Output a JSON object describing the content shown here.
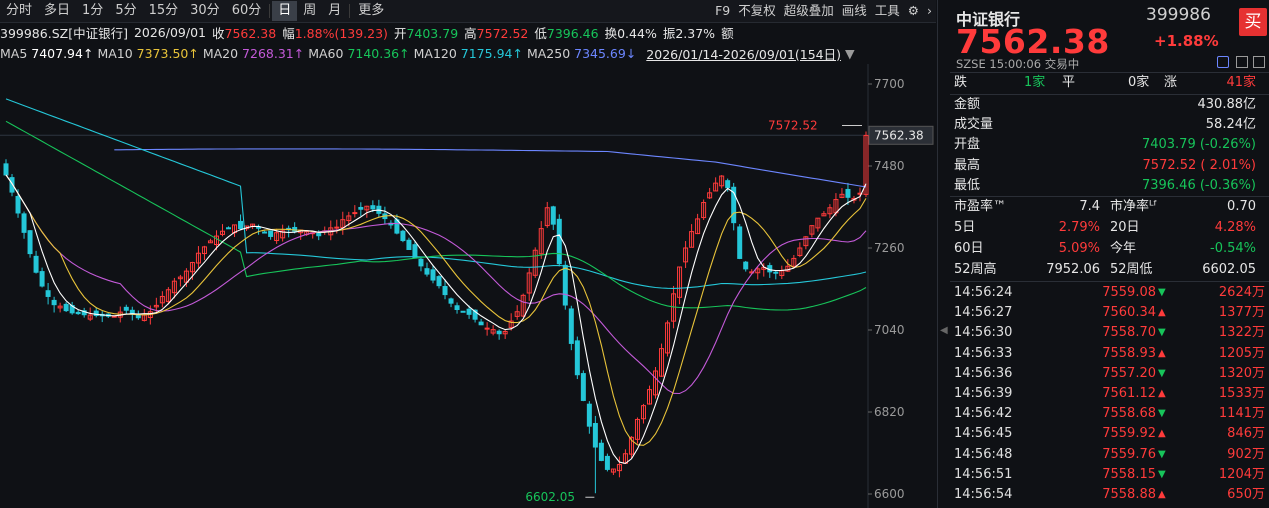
{
  "toolbar": {
    "periods": [
      "分时",
      "多日",
      "1分",
      "5分",
      "15分",
      "30分",
      "60分",
      "日",
      "周",
      "月",
      "更多"
    ],
    "active": "日",
    "right": [
      "F9",
      "不复权",
      "超级叠加",
      "画线",
      "工具"
    ],
    "gear": "gear-icon",
    "chevron": "chevron-right-icon"
  },
  "info": {
    "code": "399986.SZ[中证银行]",
    "date": "2026/09/01",
    "close_label": "收",
    "close": "7562.38",
    "change_label": "幅",
    "change": "1.88%(139.23)",
    "open_label": "开",
    "open": "7403.79",
    "high_label": "高",
    "high": "7572.52",
    "low_label": "低",
    "low": "7396.46",
    "turnover_label": "换",
    "turnover": "0.44%",
    "amplitude_label": "振",
    "amplitude": "2.37%",
    "amount_label": "额"
  },
  "ma": {
    "items": [
      {
        "label": "MA5",
        "value": "7407.94↑",
        "color": "#ffffff"
      },
      {
        "label": "MA10",
        "value": "7373.50↑",
        "color": "#e8c33a"
      },
      {
        "label": "MA20",
        "value": "7268.31↑",
        "color": "#c35ad8"
      },
      {
        "label": "MA60",
        "value": "7140.36↑",
        "color": "#17c45a"
      },
      {
        "label": "MA120",
        "value": "7175.94↑",
        "color": "#25c7d8"
      },
      {
        "label": "MA250",
        "value": "7345.69↓",
        "color": "#6c86ff"
      }
    ],
    "range": "2026/01/14-2026/09/01(154日)"
  },
  "quote": {
    "name": "中证银行",
    "code": "399986",
    "price": "7562.38",
    "pct": "+1.88%",
    "buy": "买",
    "market": "SZSE",
    "time": "15:00:06",
    "status": "交易中",
    "breadth": {
      "down_label": "跌",
      "down": "1家",
      "flat_label": "平",
      "flat": "0家",
      "up_label": "涨",
      "up": "41家"
    },
    "stats": [
      {
        "label": "金额",
        "value": "430.88亿",
        "cls": "white"
      },
      {
        "label": "成交量",
        "value": "58.24亿",
        "cls": "white"
      },
      {
        "label": "开盘",
        "value": "7403.79 (-0.26%)",
        "cls": "green"
      },
      {
        "label": "最高",
        "value": "7572.52 ( 2.01%)",
        "cls": "red"
      },
      {
        "label": "最低",
        "value": "7396.46 (-0.36%)",
        "cls": "green"
      }
    ],
    "valuation": [
      {
        "l1": "市盈率™",
        "v1": "7.4",
        "c1": "white",
        "l2": "市净率ᴸᶠ",
        "v2": "0.70",
        "c2": "white"
      },
      {
        "l1": "5日",
        "v1": "2.79%",
        "c1": "red",
        "l2": "20日",
        "v2": "4.28%",
        "c2": "red"
      },
      {
        "l1": "60日",
        "v1": "5.09%",
        "c1": "red",
        "l2": "今年",
        "v2": "-0.54%",
        "c2": "green"
      },
      {
        "l1": "52周高",
        "v1": "7952.06",
        "c1": "white",
        "l2": "52周低",
        "v2": "6602.05",
        "c2": "white"
      }
    ],
    "ticks": [
      {
        "time": "14:56:24",
        "price": "7559.08",
        "dir": "down",
        "vol": "2624万"
      },
      {
        "time": "14:56:27",
        "price": "7560.34",
        "dir": "up",
        "vol": "1377万"
      },
      {
        "time": "14:56:30",
        "price": "7558.70",
        "dir": "down",
        "vol": "1322万"
      },
      {
        "time": "14:56:33",
        "price": "7558.93",
        "dir": "up",
        "vol": "1205万"
      },
      {
        "time": "14:56:36",
        "price": "7557.20",
        "dir": "down",
        "vol": "1320万"
      },
      {
        "time": "14:56:39",
        "price": "7561.12",
        "dir": "up",
        "vol": "1533万"
      },
      {
        "time": "14:56:42",
        "price": "7558.68",
        "dir": "down",
        "vol": "1141万"
      },
      {
        "time": "14:56:45",
        "price": "7559.92",
        "dir": "up",
        "vol": "846万"
      },
      {
        "time": "14:56:48",
        "price": "7559.76",
        "dir": "down",
        "vol": "902万"
      },
      {
        "time": "14:56:51",
        "price": "7558.15",
        "dir": "down",
        "vol": "1204万"
      },
      {
        "time": "14:56:54",
        "price": "7558.88",
        "dir": "up",
        "vol": "650万"
      }
    ]
  },
  "chart_data": {
    "type": "candlestick",
    "title": "399986.SZ[中证银行]",
    "y_ticks": [
      7700,
      7480,
      7260,
      7040,
      6820,
      6600
    ],
    "ylim": [
      6600,
      7700
    ],
    "last_price": 7562.38,
    "high_marker": {
      "label": "7572.52",
      "value": 7572.52
    },
    "low_marker": {
      "label": "6602.05",
      "value": 6602.05
    },
    "colors": {
      "up": "#ff3b3b",
      "down": "#25c7d8",
      "ma5": "#ffffff",
      "ma10": "#e8c33a",
      "ma20": "#c35ad8",
      "ma60": "#17c45a",
      "ma120": "#25c7d8",
      "ma250": "#6c86ff"
    },
    "closes": [
      7456,
      7410,
      7354,
      7302,
      7245,
      7195,
      7158,
      7130,
      7108,
      7104,
      7092,
      7086,
      7084,
      7081,
      7080,
      7079,
      7078,
      7077,
      7077,
      7088,
      7093,
      7084,
      7073,
      7080,
      7089,
      7106,
      7130,
      7148,
      7171,
      7182,
      7198,
      7221,
      7246,
      7263,
      7279,
      7292,
      7305,
      7313,
      7322,
      7312,
      7319,
      7324,
      7313,
      7302,
      7291,
      7301,
      7306,
      7309,
      7305,
      7308,
      7304,
      7301,
      7293,
      7306,
      7314,
      7316,
      7336,
      7346,
      7355,
      7364,
      7372,
      7365,
      7353,
      7339,
      7322,
      7300,
      7280,
      7256,
      7233,
      7212,
      7190,
      7174,
      7159,
      7135,
      7112,
      7095,
      7089,
      7082,
      7069,
      7054,
      7045,
      7041,
      7030,
      7036,
      7064,
      7089,
      7133,
      7193,
      7254,
      7312,
      7368,
      7324,
      7218,
      7107,
      7004,
      6920,
      6851,
      6782,
      6726,
      6690,
      6666,
      6667,
      6679,
      6708,
      6752,
      6800,
      6837,
      6880,
      6930,
      6990,
      7059,
      7137,
      7209,
      7260,
      7304,
      7338,
      7382,
      7408,
      7434,
      7453,
      7422,
      7328,
      7232,
      7204,
      7196,
      7204,
      7208,
      7196,
      7193,
      7199,
      7211,
      7232,
      7260,
      7290,
      7320,
      7340,
      7352,
      7368,
      7390,
      7404,
      7396,
      7393,
      7407,
      7562
    ]
  }
}
